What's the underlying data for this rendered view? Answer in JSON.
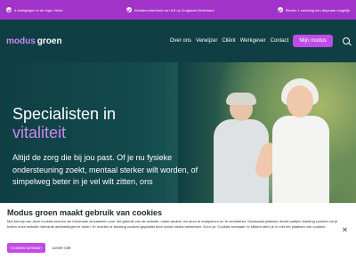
{
  "topbar": {
    "usp1": "4 vestigingen in de regio Venlo",
    "usp2": "Klanttevredenheid van 8.8 op Zorgkaart Nederland",
    "usp3": "Binnen 1 werkdag een afspraak mogelijk"
  },
  "header": {
    "logo_part1": "modus",
    "logo_part2": "groen",
    "nav": [
      "Over ons",
      "Verwijzer",
      "Cliënt",
      "Werkgever",
      "Contact"
    ],
    "cta": "Mijn modus"
  },
  "hero": {
    "title_line1": "Specialisten in",
    "title_line2": "vitaliteit",
    "lead_lines": [
      "Altijd de zorg die bij jou past. Of je nu fysieke",
      "ondersteuning zoekt, mentaal sterker wilt worden, of",
      "simpelweg beter in je vel wilt zitten, ons"
    ]
  },
  "cookie": {
    "title": "Modus groen maakt gebruik van cookies",
    "text": "Met behulp van deze cookies kunnen we informatie verzamelen over het gebruik van de website, onder andere om deze te analyseren en te verbeteren. Daarnaast plaatsen derde partijen tracking cookies om je buiten onze website relevante aanbiedingen te tonen. Er worden er tracking cookies geplaatst door social media-netwerken. Door op 'Cookies toestaan' te klikken stem je in met het plaatsen van cookies.",
    "accept": "Cookies toestaan",
    "reject": "Liever niet"
  },
  "colors": {
    "brand_purple": "#a233c9",
    "accent_pink": "#c04be6",
    "dark_teal": "#0f3f44"
  }
}
